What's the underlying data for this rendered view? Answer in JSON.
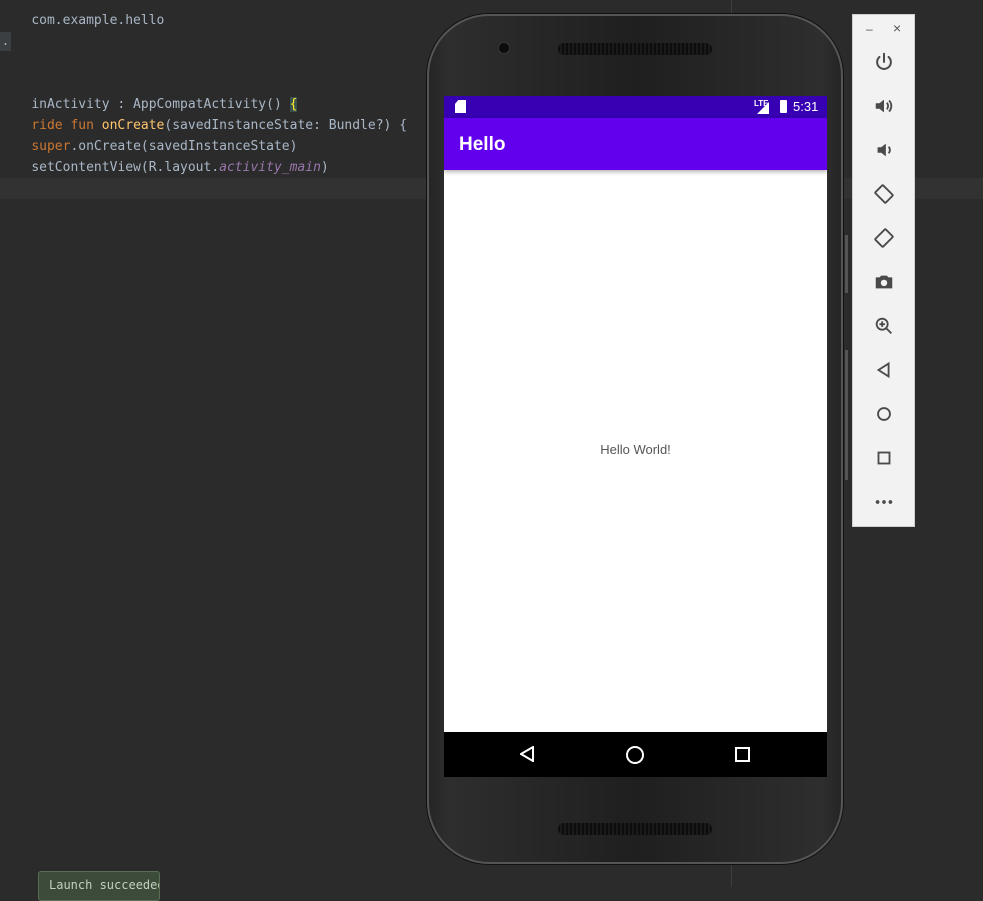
{
  "editor": {
    "lines": [
      {
        "parts": [
          {
            "t": "com.example.hello",
            "c": ""
          }
        ]
      },
      {
        "parts": [
          {
            "t": "inActivity : AppCompatActivity() ",
            "c": ""
          },
          {
            "t": "{",
            "c": "brace-hl"
          }
        ]
      },
      {
        "parts": [
          {
            "t": "ride fun ",
            "c": "kw"
          },
          {
            "t": "onCreate",
            "c": "fn"
          },
          {
            "t": "(savedInstanceState: Bundle?) {",
            "c": ""
          }
        ]
      },
      {
        "parts": [
          {
            "t": "super",
            "c": "kw"
          },
          {
            "t": ".onCreate(savedInstanceState)",
            "c": ""
          }
        ]
      },
      {
        "parts": [
          {
            "t": "setContentView(R.layout.",
            "c": ""
          },
          {
            "t": "activity_main",
            "c": "it"
          },
          {
            "t": ")",
            "c": ""
          }
        ]
      }
    ],
    "fold_marker": ".",
    "toast": "Launch succeeded"
  },
  "phone": {
    "status_time": "5:31",
    "network_label": "LTE",
    "app_title": "Hello",
    "body_text": "Hello World!"
  },
  "toolbar": {
    "minimize": "–",
    "close": "×",
    "buttons": [
      {
        "name": "power-icon"
      },
      {
        "name": "volume-up-icon"
      },
      {
        "name": "volume-down-icon"
      },
      {
        "name": "rotate-left-icon"
      },
      {
        "name": "rotate-right-icon"
      },
      {
        "name": "camera-icon"
      },
      {
        "name": "zoom-icon"
      },
      {
        "name": "back-icon"
      },
      {
        "name": "home-icon"
      },
      {
        "name": "overview-icon"
      },
      {
        "name": "more-icon"
      }
    ]
  },
  "colors": {
    "editor_bg": "#2b2b2b",
    "status_bar": "#3700b3",
    "app_bar": "#6200ee"
  }
}
